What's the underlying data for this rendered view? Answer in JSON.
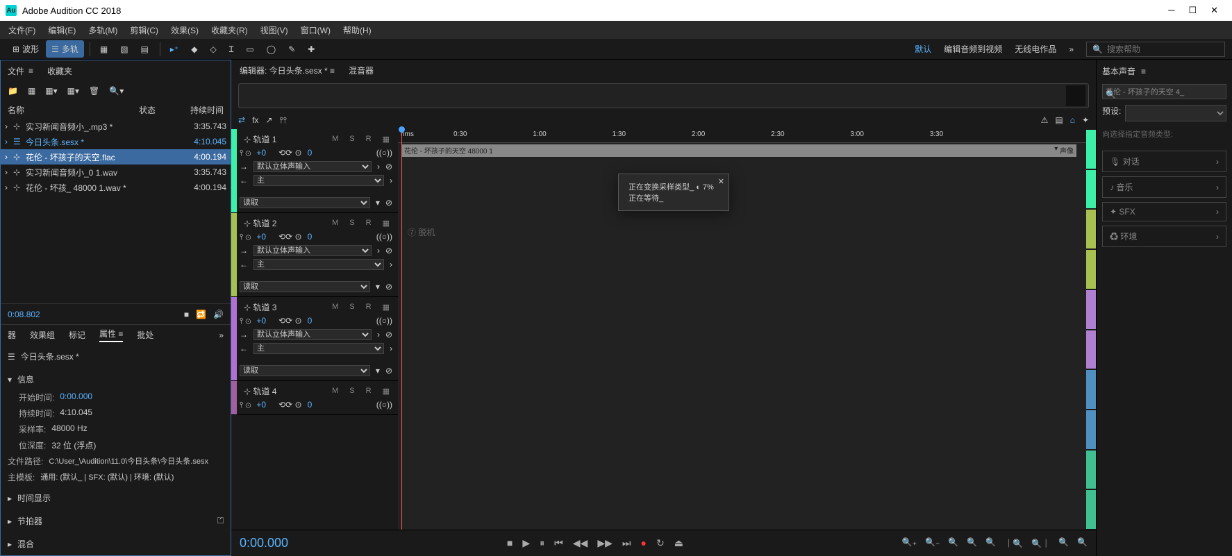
{
  "title": "Adobe Audition CC 2018",
  "menu": [
    "文件(F)",
    "编辑(E)",
    "多轨(M)",
    "剪辑(C)",
    "效果(S)",
    "收藏夹(R)",
    "视图(V)",
    "窗口(W)",
    "帮助(H)"
  ],
  "toolbar": {
    "waveform": "波形",
    "multitrack": "多轨",
    "workspaces": [
      "默认",
      "编辑音频到视频",
      "无线电作品"
    ],
    "search_ph": "搜索帮助"
  },
  "left": {
    "tab_files": "文件",
    "tab_favorites": "收藏夹",
    "cols": {
      "name": "名称",
      "status": "状态",
      "duration": "持续时间"
    },
    "files": [
      {
        "name": "实习新闻音频小_.mp3 *",
        "dur": "3:35.743"
      },
      {
        "name": "今日头条.sesx *",
        "dur": "4:10.045",
        "highlighted": true
      },
      {
        "name": "花伦 - 坏孩子的天空.flac",
        "dur": "4:00.194",
        "selected": true
      },
      {
        "name": "实习新闻音频小_0 1.wav",
        "dur": "3:35.743"
      },
      {
        "name": "花伦 - 坏孩_ 48000 1.wav *",
        "dur": "4:00.194"
      }
    ],
    "mini_time": "0:08.802",
    "prop_tabs": [
      "器",
      "效果组",
      "标记",
      "属性",
      "批处"
    ],
    "prop_title": "今日头条.sesx *",
    "info": {
      "label": "信息",
      "start": {
        "label": "开始时间:",
        "value": "0:00.000"
      },
      "duration": {
        "label": "持续时间:",
        "value": "4:10.045"
      },
      "samplerate": {
        "label": "采样率:",
        "value": "48000 Hz"
      },
      "bitdepth": {
        "label": "位深度:",
        "value": "32 位 (浮点)"
      },
      "path": {
        "label": "文件路径:",
        "value": "C:\\User_\\Audition\\11.0\\今日头条\\今日头条.sesx"
      },
      "template": {
        "label": "主模板:",
        "value": "通用: (默认_ | SFX: (默认) | 环境: (默认)"
      }
    },
    "sections": [
      "时间显示",
      "节拍器",
      "混合"
    ]
  },
  "center": {
    "editor_label": "编辑器: 今日头条.sesx *",
    "mixer_label": "混音器",
    "ruler_start": "hms",
    "ruler_ticks": [
      "0:30",
      "1:00",
      "1:30",
      "2:00",
      "2:30",
      "3:00",
      "3:30"
    ],
    "clip_name": "花伦 - 坏孩子的天空 48000 1",
    "clip_badge": "声像",
    "hint": "脱机",
    "tracks": [
      {
        "name": "轨道 1",
        "color": "#3cf0a8",
        "vol": "+0",
        "pan": "0",
        "input": "默认立体声输入",
        "output": "主",
        "read": "读取"
      },
      {
        "name": "轨道 2",
        "color": "#a8c050",
        "vol": "+0",
        "pan": "0",
        "input": "默认立体声输入",
        "output": "主",
        "read": "读取"
      },
      {
        "name": "轨道 3",
        "color": "#b070d0",
        "vol": "+0",
        "pan": "0",
        "input": "默认立体声输入",
        "output": "主",
        "read": "读取"
      },
      {
        "name": "轨道 4",
        "color": "#a060a0",
        "vol": "+0",
        "pan": "0"
      }
    ],
    "msr": [
      "M",
      "S",
      "R"
    ],
    "timecode": "0:00.000",
    "meter_colors": [
      "#3cf0a8",
      "#3cf0a8",
      "#a8c050",
      "#a8c050",
      "#b080d0",
      "#b080d0",
      "#5090c0",
      "#5090c0",
      "#40c090",
      "#40c090"
    ]
  },
  "right": {
    "title": "基本声音",
    "clip_ph": "花伦 - 坏孩子的天空 4_",
    "preset_label": "预设:",
    "hint": "向选择指定音频类型:",
    "buttons": [
      "🎙 对话",
      "♪ 音乐",
      "✦ SFX",
      "♻ 环境"
    ]
  },
  "dialog": {
    "line1": "正在变换采样类型_ ◐ 7%",
    "line2": "正在等待_"
  }
}
